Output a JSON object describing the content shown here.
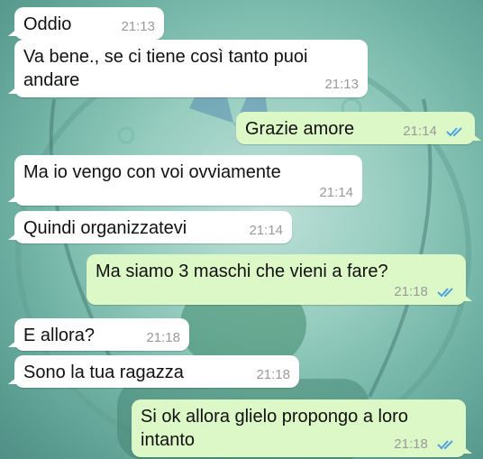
{
  "messages": [
    {
      "text": "Oddio",
      "time": "21:13",
      "dir": "in"
    },
    {
      "text": "Va bene., se ci tiene così tanto puoi andare",
      "time": "21:13",
      "dir": "in"
    },
    {
      "text": "Grazie amore",
      "time": "21:14",
      "dir": "out",
      "read": true
    },
    {
      "text": "Ma io vengo con voi ovviamente",
      "time": "21:14",
      "dir": "in"
    },
    {
      "text": "Quindi organizzatevi",
      "time": "21:14",
      "dir": "in"
    },
    {
      "text": "Ma siamo 3 maschi che vieni a fare?",
      "time": "21:18",
      "dir": "out",
      "read": true
    },
    {
      "text": "E allora?",
      "time": "21:18",
      "dir": "in"
    },
    {
      "text": "Sono la tua ragazza",
      "time": "21:18",
      "dir": "in"
    },
    {
      "text": "Si ok allora glielo propongo a loro intanto",
      "time": "21:18",
      "dir": "out",
      "read": true
    }
  ],
  "colors": {
    "incoming": "#ffffff",
    "outgoing": "#dcf8c6",
    "read_ticks": "#4fa3e0"
  }
}
